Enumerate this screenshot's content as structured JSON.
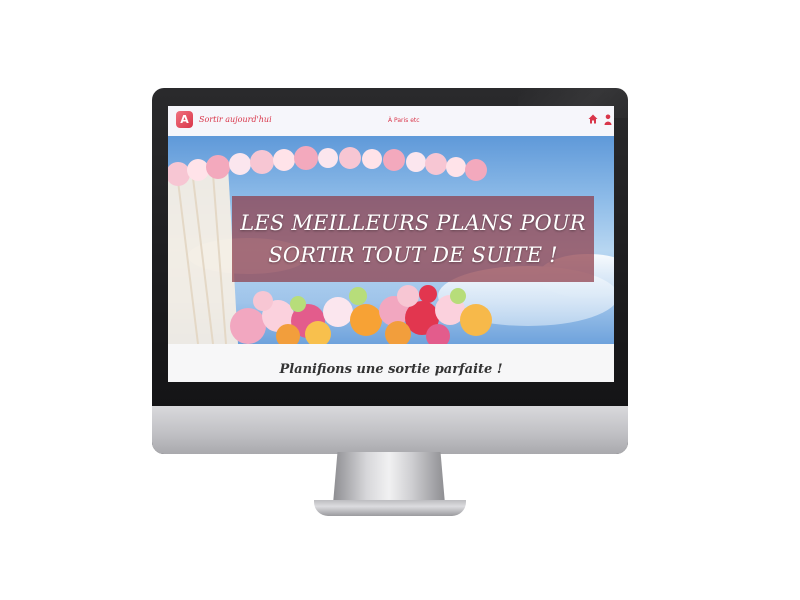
{
  "navbar": {
    "brand": "Sortir aujourd'hui",
    "center_link": "À Paris etc",
    "logo_icon": "app-logo-icon",
    "home_icon": "home-icon",
    "user_icon": "user-icon"
  },
  "hero": {
    "headline": "LES MEILLEURS PLANS POUR SORTIR TOUT DE SUITE !"
  },
  "section": {
    "subtitle": "Planifions une sortie parfaite !"
  },
  "colors": {
    "accent": "#d9364a",
    "banner": "#8d3c48",
    "sky": "#8dbbe8"
  }
}
